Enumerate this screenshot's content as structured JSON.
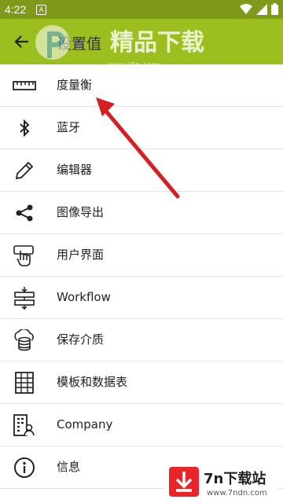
{
  "status_bar": {
    "time": "4:22",
    "notification": "A"
  },
  "app_bar": {
    "title": "设置值",
    "back_icon": "arrow-back-icon"
  },
  "watermark": {
    "brand": "精品下载",
    "url": "www.j9p.com"
  },
  "menu": [
    {
      "label": "度量衡",
      "icon": "ruler-icon"
    },
    {
      "label": "蓝牙",
      "icon": "bluetooth-icon"
    },
    {
      "label": "编辑器",
      "icon": "pencil-icon"
    },
    {
      "label": "图像导出",
      "icon": "share-icon"
    },
    {
      "label": "用户界面",
      "icon": "touch-icon"
    },
    {
      "label": "Workflow",
      "icon": "workflow-icon"
    },
    {
      "label": "保存介质",
      "icon": "cloud-storage-icon"
    },
    {
      "label": "模板和数据表",
      "icon": "grid-table-icon"
    },
    {
      "label": "Company",
      "icon": "company-icon"
    },
    {
      "label": "信息",
      "icon": "info-icon"
    }
  ],
  "bottom_badge": {
    "title": "7n下载站",
    "url": "www.7ndn.com"
  },
  "colors": {
    "status_bar": "#7f9a1a",
    "app_bar": "#9cbf1f",
    "arrow": "#d42020"
  }
}
